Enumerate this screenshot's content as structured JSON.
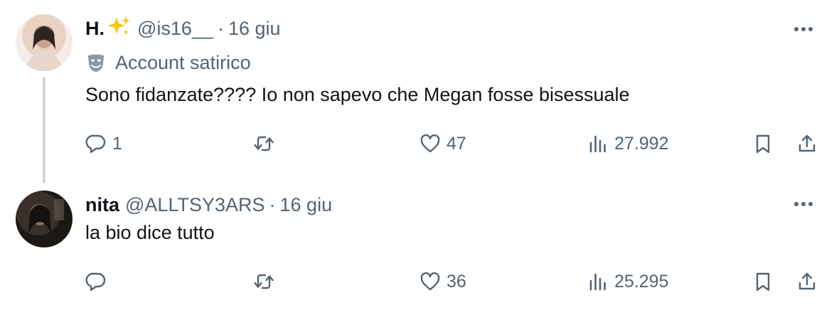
{
  "tweets": [
    {
      "name": "H.",
      "handle": "@is16__",
      "separator": "·",
      "date": "16 giu",
      "label": "Account satirico",
      "text": "Sono fidanzate???? Io non sapevo che Megan fosse bisessuale",
      "replies": "1",
      "retweets": "",
      "likes": "47",
      "views": "27.992"
    },
    {
      "name": "nita",
      "handle": "@ALLTSY3ARS",
      "separator": "·",
      "date": "16 giu",
      "text": "la bio dice tutto",
      "replies": "",
      "retweets": "",
      "likes": "36",
      "views": "25.295"
    }
  ],
  "icons": {
    "sparkle": "sparkles-icon",
    "label": "theater-mask-icon",
    "more": "more-dots-icon",
    "reply": "reply-icon",
    "retweet": "retweet-icon",
    "like": "heart-icon",
    "views": "views-icon",
    "bookmark": "bookmark-icon",
    "share": "share-icon"
  },
  "colors": {
    "text": "#0f1419",
    "secondary": "#536471",
    "thread_line": "#cfd9de",
    "sparkle": "#f5c518"
  }
}
